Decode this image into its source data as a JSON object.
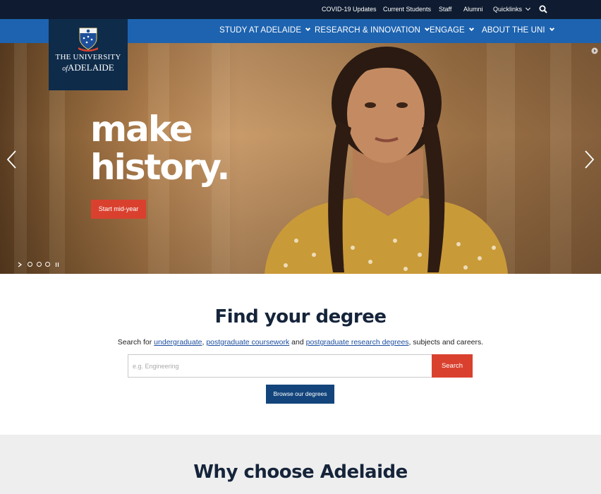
{
  "topbar": {
    "links": [
      "COVID-19 Updates",
      "Current Students",
      "Staff",
      "Alumni",
      "Quicklinks"
    ],
    "search_icon": "search-icon"
  },
  "logo": {
    "line1": "THE UNIVERSITY",
    "line2_of": "of",
    "line2_name": "ADELAIDE"
  },
  "nav": {
    "items": [
      "STUDY AT ADELAIDE",
      "RESEARCH & INNOVATION",
      "ENGAGE",
      "ABOUT THE UNI"
    ]
  },
  "hero": {
    "headline_line1": "make",
    "headline_line2": "history.",
    "cta": "Start mid-year",
    "slide_count": 4,
    "controls": [
      "prev-arrow-icon",
      "next-arrow-icon",
      "play-icon",
      "pause-icon"
    ]
  },
  "find": {
    "title": "Find your degree",
    "desc_prefix": "Search for",
    "link_undergrad": "undergraduate",
    "link_pg_coursework": "postgraduate coursework",
    "link_pg_research": "postgraduate research degrees",
    "desc_and": "and",
    "desc_suffix": ", subjects and careers.",
    "search_placeholder": "e.g. Engineering",
    "search_button": "Search",
    "browse_button": "Browse our degrees"
  },
  "why": {
    "title": "Why choose Adelaide"
  },
  "colors": {
    "topbar": "#0e1b30",
    "nav": "#1d63b0",
    "logo_bg": "#0e2b4a",
    "accent_red": "#d9412e",
    "button_blue": "#13457c",
    "heading": "#15243a"
  }
}
